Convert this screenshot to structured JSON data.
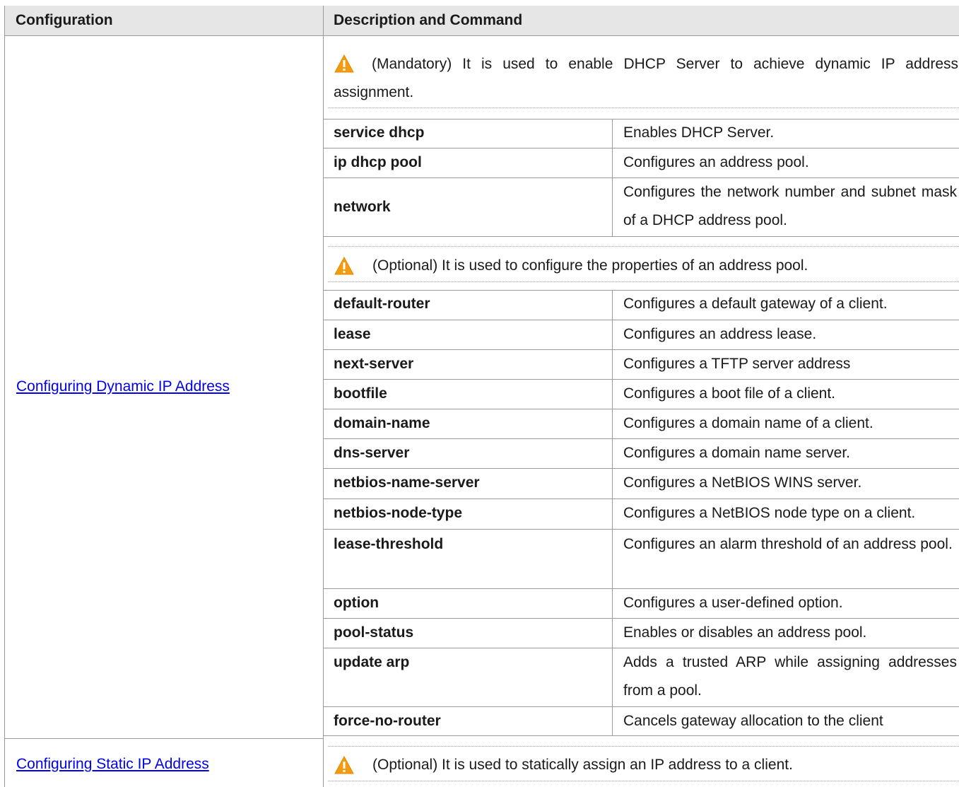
{
  "header": {
    "col1": "Configuration",
    "col2": "Description and Command"
  },
  "dynamic": {
    "link": "Configuring Dynamic IP Address",
    "mandatory_note": "(Mandatory) It is used to enable DHCP Server to achieve dynamic IP address assignment.",
    "optional_note": "(Optional) It is used to configure the properties of an address pool.",
    "mandatory_rows": [
      {
        "cmd": "service dhcp",
        "desc": "Enables DHCP Server."
      },
      {
        "cmd": "ip dhcp pool",
        "desc": "Configures an address pool."
      },
      {
        "cmd": "network",
        "desc": "Configures the network number and subnet mask of a DHCP address pool."
      }
    ],
    "optional_rows": [
      {
        "cmd": "default-router",
        "desc": "Configures a default gateway of a client."
      },
      {
        "cmd": "lease",
        "desc": "Configures an address lease."
      },
      {
        "cmd": "next-server",
        "desc": "Configures a TFTP server address"
      },
      {
        "cmd": "bootfile",
        "desc": "Configures a boot file of a client."
      },
      {
        "cmd": "domain-name",
        "desc": "Configures a domain name of a client."
      },
      {
        "cmd": "dns-server",
        "desc": "Configures a domain name server."
      },
      {
        "cmd": "netbios-name-server",
        "desc": "Configures a NetBIOS WINS server."
      },
      {
        "cmd": "netbios-node-type",
        "desc": "Configures a NetBIOS node type on a client."
      },
      {
        "cmd": "lease-threshold",
        "desc": "Configures an alarm threshold of an address pool."
      },
      {
        "cmd": "option",
        "desc": "Configures a user-defined option."
      },
      {
        "cmd": "pool-status",
        "desc": "Enables or disables an address pool."
      },
      {
        "cmd": "update arp",
        "desc": "Adds a trusted ARP while assigning addresses from a pool."
      },
      {
        "cmd": "force-no-router",
        "desc": "Cancels gateway allocation to the client"
      }
    ]
  },
  "static": {
    "link": "Configuring Static IP Address",
    "optional_note": "(Optional) It is used to statically assign an IP address to a client."
  },
  "colors": {
    "header_bg": "#e6e6e6",
    "border": "#9a9a9a",
    "link": "#0000ee",
    "warning_fill": "#f39c12"
  },
  "icons": [
    "warning-icon"
  ]
}
